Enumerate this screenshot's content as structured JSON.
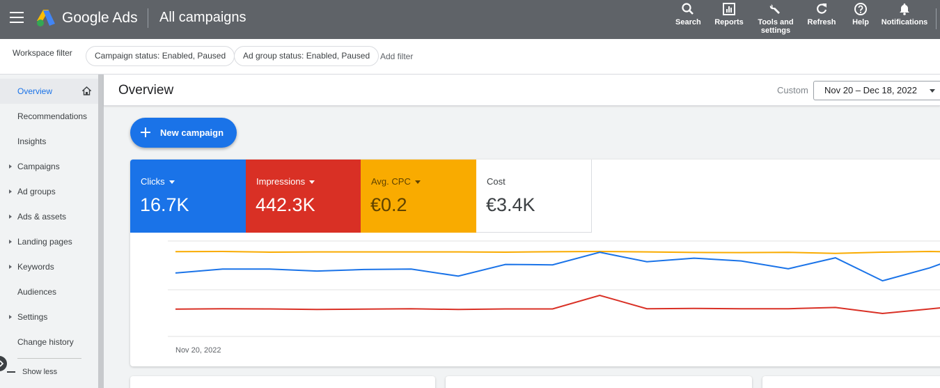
{
  "app": {
    "brand": "Google Ads",
    "page_heading": "All campaigns"
  },
  "toolbar": {
    "search": "Search",
    "reports": "Reports",
    "tools_line1": "Tools and",
    "tools_line2": "settings",
    "refresh": "Refresh",
    "help": "Help",
    "notifications": "Notifications"
  },
  "filters": {
    "label": "Workspace filter",
    "chips": [
      "Campaign status: Enabled, Paused",
      "Ad group status: Enabled, Paused"
    ],
    "add_filter": "Add filter"
  },
  "sidebar": {
    "items": [
      {
        "label": "Overview",
        "active": true
      },
      {
        "label": "Recommendations"
      },
      {
        "label": "Insights"
      },
      {
        "label": "Campaigns",
        "expandable": true
      },
      {
        "label": "Ad groups",
        "expandable": true
      },
      {
        "label": "Ads & assets",
        "expandable": true
      },
      {
        "label": "Landing pages",
        "expandable": true
      },
      {
        "label": "Keywords",
        "expandable": true
      },
      {
        "label": "Audiences"
      },
      {
        "label": "Settings",
        "expandable": true
      },
      {
        "label": "Change history"
      }
    ],
    "show_less": "Show less"
  },
  "overview": {
    "title": "Overview",
    "date_label": "Custom",
    "date_range": "Nov 20 – Dec 18, 2022",
    "new_campaign": "New campaign",
    "metrics": [
      {
        "label": "Clicks",
        "value": "16.7K",
        "color": "#1a73e8"
      },
      {
        "label": "Impressions",
        "value": "442.3K",
        "color": "#d93025"
      },
      {
        "label": "Avg. CPC",
        "value": "€0.2",
        "color": "#f9ab00"
      },
      {
        "label": "Cost",
        "value": "€3.4K",
        "color": "#ffffff"
      }
    ],
    "x_start_label": "Nov 20, 2022"
  },
  "chart_data": {
    "type": "line",
    "title": "",
    "xlabel": "",
    "ylabel": "",
    "grid": true,
    "x_first_label": "Nov 20, 2022",
    "series": [
      {
        "color": "#f9ab00",
        "values": [
          0.24,
          0.25,
          0.2,
          0.22,
          0.22,
          0.22,
          0.22,
          0.2,
          0.23,
          0.25,
          0.22,
          0.18,
          0.17,
          0.19,
          0.11,
          0.2,
          0.25,
          0.18
        ]
      },
      {
        "color": "#1a73e8",
        "values": [
          0.43,
          0.53,
          0.53,
          0.48,
          0.52,
          0.53,
          0.35,
          0.65,
          0.64,
          0.96,
          0.72,
          0.81,
          0.74,
          0.54,
          0.82,
          0.23,
          0.56,
          1.0
        ]
      },
      {
        "color": "#d93025",
        "values": [
          0.24,
          0.26,
          0.25,
          0.22,
          0.24,
          0.26,
          0.22,
          0.25,
          0.25,
          1.0,
          0.26,
          0.28,
          0.26,
          0.26,
          0.33,
          0.0,
          0.25,
          0.5
        ]
      }
    ]
  }
}
